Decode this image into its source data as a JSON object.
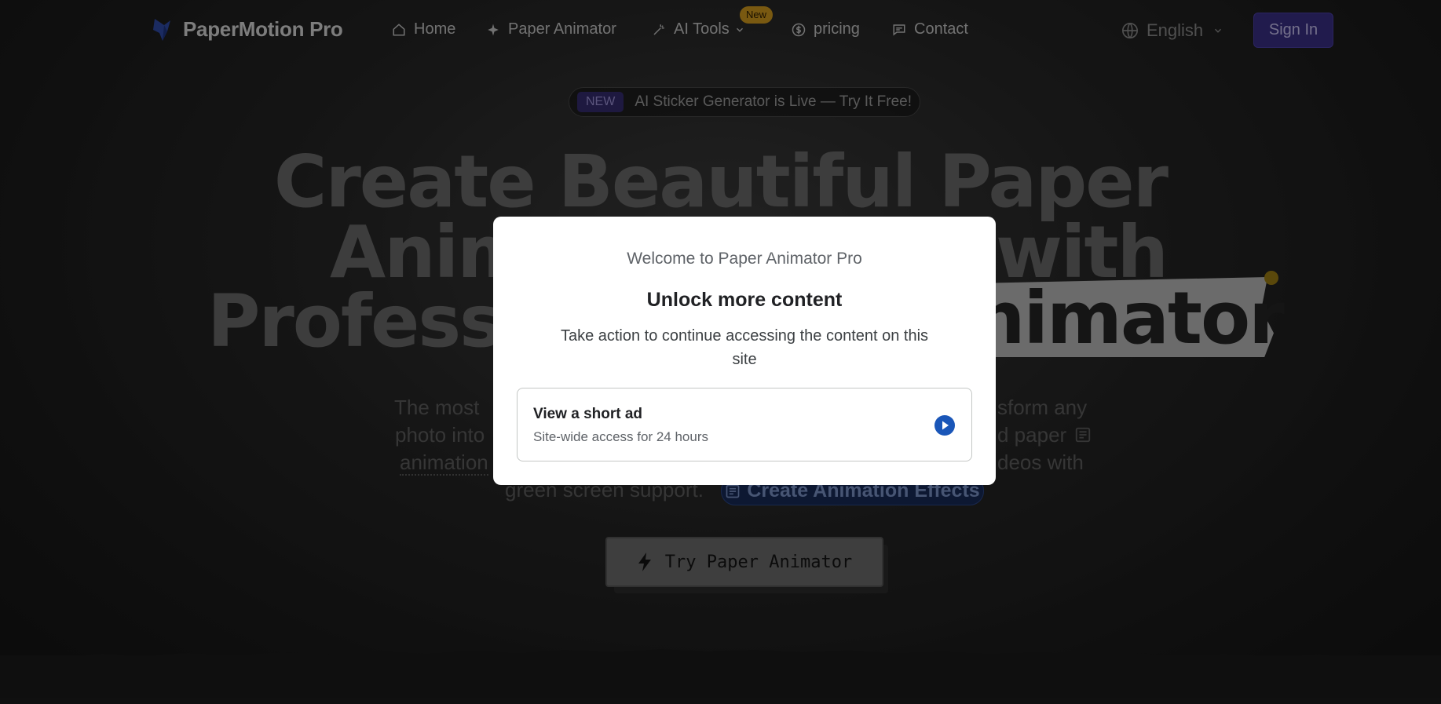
{
  "nav": {
    "brand": "PaperMotion Pro",
    "items": [
      {
        "label": "Home",
        "icon": "home-icon"
      },
      {
        "label": "Paper Animator",
        "icon": "sparkle-icon"
      },
      {
        "label": "AI Tools",
        "icon": "wand-icon",
        "badge": "New"
      },
      {
        "label": "pricing",
        "icon": "dollar-icon"
      },
      {
        "label": "Contact",
        "icon": "message-icon"
      }
    ],
    "language": "English",
    "signin": "Sign In"
  },
  "announcement": {
    "badge": "NEW",
    "text": "AI Sticker Generator is Live — Try It Free!"
  },
  "hero": {
    "line1": "Create Beautiful Paper",
    "line2_left": "Anim",
    "line2_right": "with",
    "line3_left": "Professi",
    "line3_sticker": "nimator",
    "desc_line1_left": "The most",
    "desc_line1_right": "sform any",
    "desc_line2_left": "photo into",
    "desc_line2_right": "d paper",
    "desc_line3_left": "animation",
    "desc_line3_right": "deos with",
    "desc_line4_left": "green screen support.",
    "effects_pill": "Create Animation Effects",
    "cta": "Try Paper Animator"
  },
  "modal": {
    "welcome": "Welcome to Paper Animator Pro",
    "title": "Unlock more content",
    "body": "Take action to continue accessing the content on this site",
    "option": {
      "title": "View a short ad",
      "subtitle": "Site-wide access for 24 hours",
      "icon": "play-icon"
    }
  },
  "colors": {
    "accent": "#3a2f86",
    "modal_play": "#1a56b8",
    "new_badge": "#d19a1e"
  }
}
